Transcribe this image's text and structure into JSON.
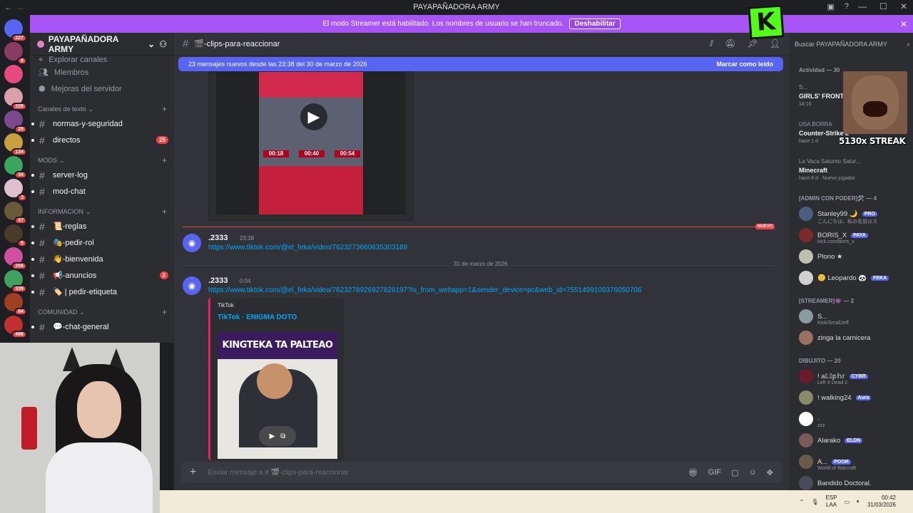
{
  "window": {
    "title": "PAYAPAÑADORA ARMY",
    "back": "←",
    "forward": "→"
  },
  "streamer_bar": {
    "message": "El modo Streamer está habilitado. Los nombres de usuario se han truncado.",
    "button": "Deshabilitar",
    "close": "✕"
  },
  "kick_logo": "K",
  "servers": [
    {
      "badge": "227",
      "color": "#5865f2"
    },
    {
      "badge": "8",
      "color": "#8b3a62"
    },
    {
      "badge": "",
      "color": "#e84a7f"
    },
    {
      "badge": "226",
      "color": "#d9a0a8"
    },
    {
      "badge": "29",
      "color": "#7a4a8c"
    },
    {
      "badge": "134",
      "color": "#c8a040"
    },
    {
      "badge": "34",
      "color": "#3aa55d"
    },
    {
      "badge": "3",
      "color": "#e0c0d0"
    },
    {
      "badge": "37",
      "color": "#6a5a3a"
    },
    {
      "badge": "5",
      "color": "#4a3a2a"
    },
    {
      "badge": "256",
      "color": "#d050a0"
    },
    {
      "badge": "339",
      "color": "#40a060"
    },
    {
      "badge": "84",
      "color": "#a04020"
    },
    {
      "badge": "496",
      "color": "#c03030"
    }
  ],
  "sidebar": {
    "server_name": "PAYAPAÑADORA ARMY",
    "nav": [
      "Explorar canales",
      "Miembros",
      "Mejoras del servidor"
    ],
    "categories": [
      {
        "name": "Canales de texto",
        "channels": [
          {
            "name": "normas-y-seguridad",
            "badge": ""
          },
          {
            "name": "directos",
            "badge": "25"
          }
        ]
      },
      {
        "name": "MODS",
        "channels": [
          {
            "name": "server-log",
            "badge": ""
          },
          {
            "name": "mod-chat",
            "badge": ""
          }
        ]
      },
      {
        "name": "INFORMACION",
        "channels": [
          {
            "name": "📜-reglas",
            "badge": ""
          },
          {
            "name": "🎭-pedir-rol",
            "badge": ""
          },
          {
            "name": "👋-bienvenida",
            "badge": ""
          },
          {
            "name": "📢-anuncios",
            "badge": "2"
          },
          {
            "name": "🏷️ | pedir-etiqueta",
            "badge": ""
          }
        ]
      },
      {
        "name": "COMUNIDAD",
        "channels": [
          {
            "name": "💬-chat-general",
            "badge": ""
          }
        ]
      }
    ]
  },
  "chat": {
    "channel": "🎬-clips-para-reaccionar",
    "new_banner": "23 mensajes nuevos desde las 23:38 del 30 de marzo de 2026",
    "mark_read": "Marcar como leído",
    "new_label": "NUEVO",
    "date_separator": "31 de marzo de 2026",
    "messages": [
      {
        "user": ".2333",
        "time": "23:38",
        "link": "https://www.tiktok.com/@el_feka/video/7623273660635303189"
      },
      {
        "user": ".2333",
        "time": "0:04",
        "link": "https://www.tiktok.com/@el_feka/video/7623278926927826197?is_from_webapp=1&sender_device=pc&web_id=7551499109376050706"
      }
    ],
    "video_labels": [
      "00:18",
      "00:40",
      "00:54"
    ],
    "embed": {
      "provider": "TikTok",
      "title": "TikTok · ENIGMA DOTO",
      "thumb_caption": "KINGTEKA TA PALTEAO"
    },
    "composer_placeholder": "Enviar mensaje a # 🎬-clips-para-reaccionar"
  },
  "members": {
    "search_placeholder": "Buscar PAYAPAÑADORA ARMY",
    "activity_header": "Actividad — 30",
    "activities": [
      {
        "user": "S...",
        "game": "GIRLS' FRONTL",
        "detail": "14:16"
      },
      {
        "user": "USA BORRA",
        "game": "Counter-Strike 2",
        "detail": "hace 1 d"
      },
      {
        "user": "La Vaca Saturno Satur...",
        "game": "Minecraft",
        "detail": "hace 8 d · Nuevo jugador"
      }
    ],
    "groups": [
      {
        "name": "[ADMIN CON PODER]🛠️ — 4",
        "members": [
          {
            "name": "Stanley99 🌙",
            "tag": "PRO",
            "sub": "こんにちは、私の名前はス"
          },
          {
            "name": "BORIS_X",
            "tag": "PAYA",
            "sub": "kick.com/boris_x"
          },
          {
            "name": "Plono ★",
            "tag": "",
            "sub": ""
          },
          {
            "name": "🙂 Leopardo 🐼",
            "tag": "FEKA",
            "sub": ""
          }
        ]
      },
      {
        "name": "[STREAMER]👾 — 2",
        "members": [
          {
            "name": "S...",
            "tag": "",
            "sub": "Kick/SmallJeff"
          },
          {
            "name": "zinga la carnicera",
            "tag": "",
            "sub": ""
          }
        ]
      },
      {
        "name": "DIBUJITO — 20",
        "members": [
          {
            "name": "! a𝕃𝕀𝕡𝕙𝕣",
            "tag": "CYBR",
            "sub": "Left 4 Dead 2"
          },
          {
            "name": "! walking24",
            "tag": "Aura",
            "sub": ""
          },
          {
            "name": "·",
            "tag": "",
            "sub": "zzz"
          },
          {
            "name": "Alarako",
            "tag": "ELDN",
            "sub": ""
          },
          {
            "name": "A...",
            "tag": "POOR",
            "sub": "World of Warcraft"
          },
          {
            "name": "Bandido Doctoral.",
            "tag": "",
            "sub": ""
          }
        ]
      }
    ]
  },
  "overlay": {
    "streak": "5130x STREAK"
  },
  "taskbar": {
    "lang": "ESP",
    "lang2": "LAA",
    "time": "00:42",
    "date": "31/03/2026"
  }
}
